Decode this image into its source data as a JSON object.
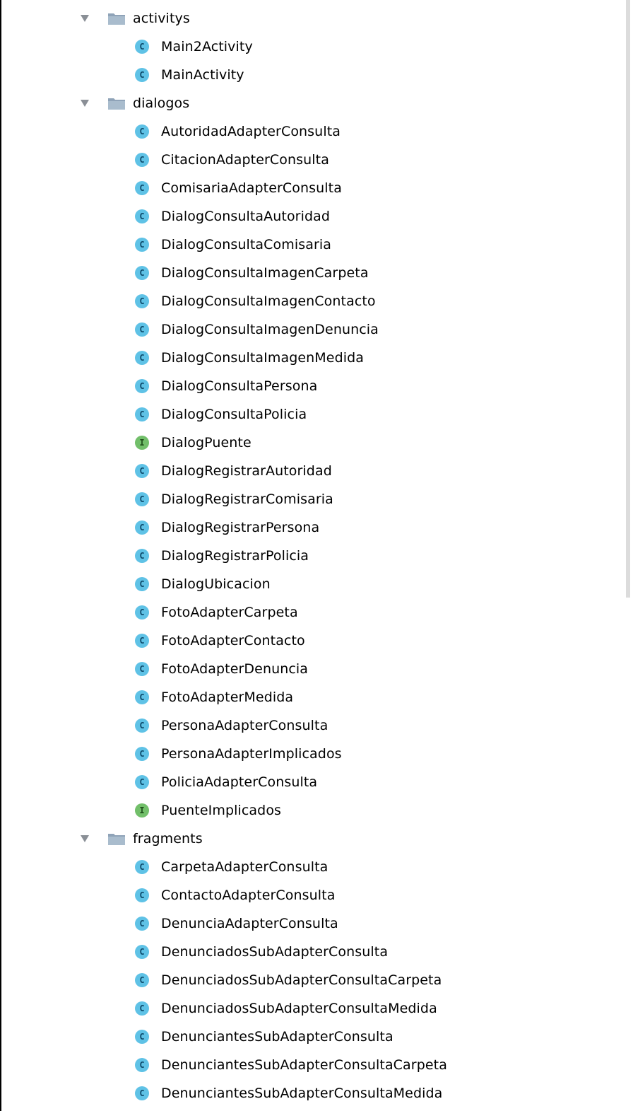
{
  "colors": {
    "class_badge": "#5fc2e6",
    "interface_badge": "#72bf6a",
    "folder": "#8fa3b8",
    "expand_arrow": "#8a8f96"
  },
  "tree": {
    "folders": [
      {
        "name": "activitys",
        "icon": "folder-icon",
        "expanded": true,
        "items": [
          {
            "name": "Main2Activity",
            "kind": "class",
            "badge": "C"
          },
          {
            "name": "MainActivity",
            "kind": "class",
            "badge": "C"
          }
        ]
      },
      {
        "name": "dialogos",
        "icon": "folder-icon",
        "expanded": true,
        "items": [
          {
            "name": "AutoridadAdapterConsulta",
            "kind": "class",
            "badge": "C"
          },
          {
            "name": "CitacionAdapterConsulta",
            "kind": "class",
            "badge": "C"
          },
          {
            "name": "ComisariaAdapterConsulta",
            "kind": "class",
            "badge": "C"
          },
          {
            "name": "DialogConsultaAutoridad",
            "kind": "class",
            "badge": "C"
          },
          {
            "name": "DialogConsultaComisaria",
            "kind": "class",
            "badge": "C"
          },
          {
            "name": "DialogConsultaImagenCarpeta",
            "kind": "class",
            "badge": "C"
          },
          {
            "name": "DialogConsultaImagenContacto",
            "kind": "class",
            "badge": "C"
          },
          {
            "name": "DialogConsultaImagenDenuncia",
            "kind": "class",
            "badge": "C"
          },
          {
            "name": "DialogConsultaImagenMedida",
            "kind": "class",
            "badge": "C"
          },
          {
            "name": "DialogConsultaPersona",
            "kind": "class",
            "badge": "C"
          },
          {
            "name": "DialogConsultaPolicia",
            "kind": "class",
            "badge": "C"
          },
          {
            "name": "DialogPuente",
            "kind": "interface",
            "badge": "I"
          },
          {
            "name": "DialogRegistrarAutoridad",
            "kind": "class",
            "badge": "C"
          },
          {
            "name": "DialogRegistrarComisaria",
            "kind": "class",
            "badge": "C"
          },
          {
            "name": "DialogRegistrarPersona",
            "kind": "class",
            "badge": "C"
          },
          {
            "name": "DialogRegistrarPolicia",
            "kind": "class",
            "badge": "C"
          },
          {
            "name": "DialogUbicacion",
            "kind": "class",
            "badge": "C"
          },
          {
            "name": "FotoAdapterCarpeta",
            "kind": "class",
            "badge": "C"
          },
          {
            "name": "FotoAdapterContacto",
            "kind": "class",
            "badge": "C"
          },
          {
            "name": "FotoAdapterDenuncia",
            "kind": "class",
            "badge": "C"
          },
          {
            "name": "FotoAdapterMedida",
            "kind": "class",
            "badge": "C"
          },
          {
            "name": "PersonaAdapterConsulta",
            "kind": "class",
            "badge": "C"
          },
          {
            "name": "PersonaAdapterImplicados",
            "kind": "class",
            "badge": "C"
          },
          {
            "name": "PoliciaAdapterConsulta",
            "kind": "class",
            "badge": "C"
          },
          {
            "name": "PuenteImplicados",
            "kind": "interface",
            "badge": "I"
          }
        ]
      },
      {
        "name": "fragments",
        "icon": "folder-icon",
        "expanded": true,
        "items": [
          {
            "name": "CarpetaAdapterConsulta",
            "kind": "class",
            "badge": "C"
          },
          {
            "name": "ContactoAdapterConsulta",
            "kind": "class",
            "badge": "C"
          },
          {
            "name": "DenunciaAdapterConsulta",
            "kind": "class",
            "badge": "C"
          },
          {
            "name": "DenunciadosSubAdapterConsulta",
            "kind": "class",
            "badge": "C"
          },
          {
            "name": "DenunciadosSubAdapterConsultaCarpeta",
            "kind": "class",
            "badge": "C"
          },
          {
            "name": "DenunciadosSubAdapterConsultaMedida",
            "kind": "class",
            "badge": "C"
          },
          {
            "name": "DenunciantesSubAdapterConsulta",
            "kind": "class",
            "badge": "C"
          },
          {
            "name": "DenunciantesSubAdapterConsultaCarpeta",
            "kind": "class",
            "badge": "C"
          },
          {
            "name": "DenunciantesSubAdapterConsultaMedida",
            "kind": "class",
            "badge": "C"
          }
        ]
      }
    ]
  }
}
